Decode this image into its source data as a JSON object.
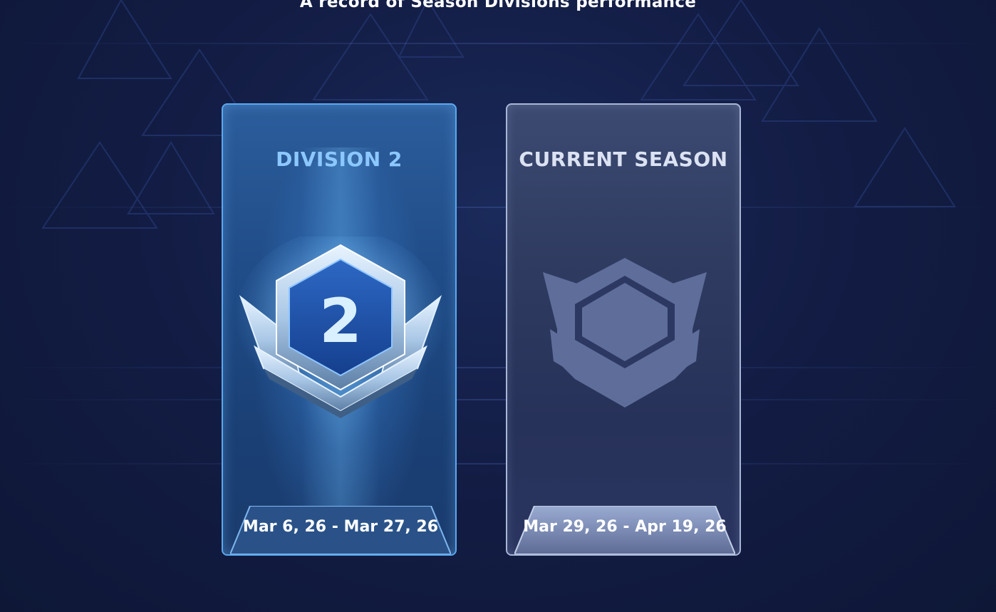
{
  "header": {
    "subtitle": "A record of Season Divisions performance"
  },
  "cards": [
    {
      "title": "DIVISION 2",
      "badge_number": "2",
      "badge_icon": "division-2-badge-icon",
      "date_range": "Mar 6, 26 - Mar 27, 26",
      "accent": "#5aa8ee"
    },
    {
      "title": "CURRENT SEASON",
      "badge_icon": "locked-division-silhouette-icon",
      "date_range": "Mar 29, 26 - Apr 19, 26",
      "accent": "#a9b6d6"
    }
  ]
}
